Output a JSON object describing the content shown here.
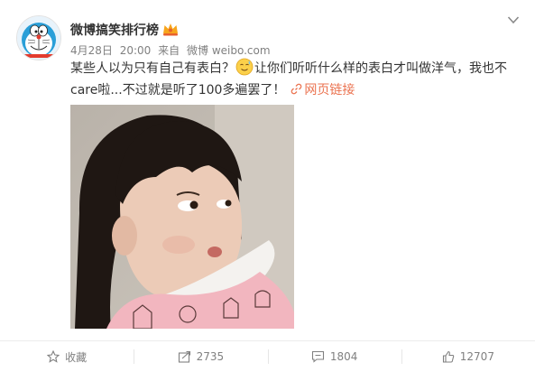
{
  "account": {
    "name": "微博搞笑排行榜",
    "avatar_icon": "doraemon-avatar",
    "badge_icon": "vip-crown-badge"
  },
  "meta": {
    "date": "4月28日",
    "time": "20:00",
    "from_label": "来自",
    "source": "微博 weibo.com"
  },
  "post": {
    "text_part1": "某些人以为只有自己有表白？",
    "emoji": "sweat-smile-emoji",
    "text_part2": "让你们听听什么样的表白才叫做洋气，我也不care啦...不过就是听了100多遍罢了！",
    "link_label": "网页链接",
    "link_icon": "link-icon"
  },
  "actions": {
    "favorite_label": "收藏",
    "repost_count": "2735",
    "comment_count": "1804",
    "like_count": "12707"
  },
  "colors": {
    "link": "#eb7350",
    "meta": "#808080",
    "text": "#333333"
  }
}
